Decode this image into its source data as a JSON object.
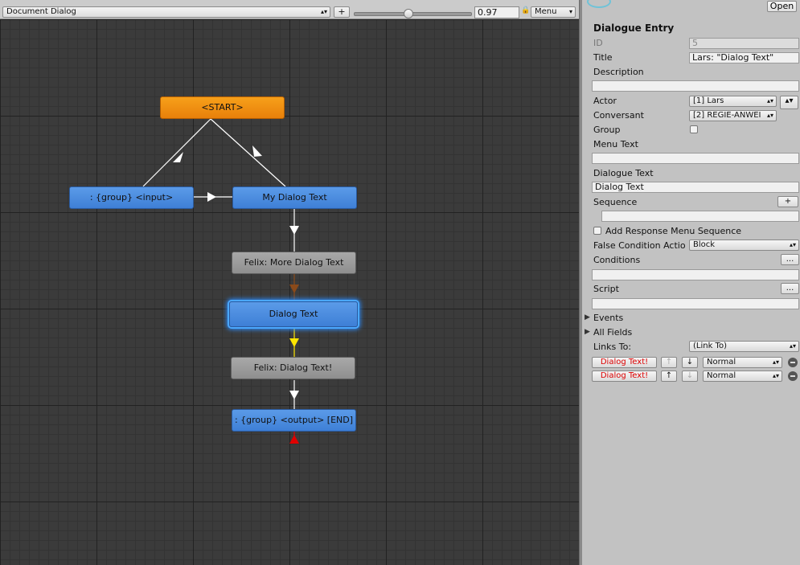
{
  "toolbar": {
    "document_select": "Document Dialog",
    "add_label": "+",
    "zoom_value": "0.97",
    "menu_label": "Menu"
  },
  "canvas": {
    "nodes": {
      "start": "<START>",
      "group_input": ": {group} <input>",
      "my_dialog": "My Dialog Text",
      "felix_more": "Felix: More Dialog Text",
      "dialog_text": "Dialog Text",
      "felix_dialog": "Felix: Dialog Text!",
      "group_output": ": {group} <output> [END]"
    }
  },
  "inspector": {
    "open_label": "Open",
    "section_title": "Dialogue Entry",
    "id_label": "ID",
    "id_value": "5",
    "title_label": "Title",
    "title_value": "Lars: \"Dialog Text\"",
    "description_label": "Description",
    "description_value": "",
    "actor_label": "Actor",
    "actor_value": "[1] Lars",
    "conversant_label": "Conversant",
    "conversant_value": "[2] REGIE-ANWEI",
    "group_label": "Group",
    "menu_text_label": "Menu Text",
    "menu_text_value": "",
    "dialogue_text_label": "Dialogue Text",
    "dialogue_text_value": "Dialog Text",
    "sequence_label": "Sequence",
    "sequence_add": "+",
    "add_response_label": "Add Response Menu Sequence",
    "false_condition_label": "False Condition Actio",
    "false_condition_value": "Block",
    "conditions_label": "Conditions",
    "conditions_btn": "...",
    "script_label": "Script",
    "script_btn": "...",
    "events_label": "Events",
    "all_fields_label": "All Fields",
    "links_to_label": "Links To:",
    "links_to_value": "(Link To)",
    "links": [
      {
        "target": "Dialog Text!",
        "priority": "Normal"
      },
      {
        "target": "Dialog Text!",
        "priority": "Normal"
      }
    ],
    "up_arrow": "↑",
    "down_arrow": "↓"
  },
  "colors": {
    "start_node": "#f39212",
    "dialog_node": "#4a8ae0",
    "npc_node": "#9a9a9a",
    "link_white": "#ffffff",
    "link_brown": "#8a4a1a",
    "link_yellow": "#ffe600",
    "link_red": "#e00000"
  }
}
